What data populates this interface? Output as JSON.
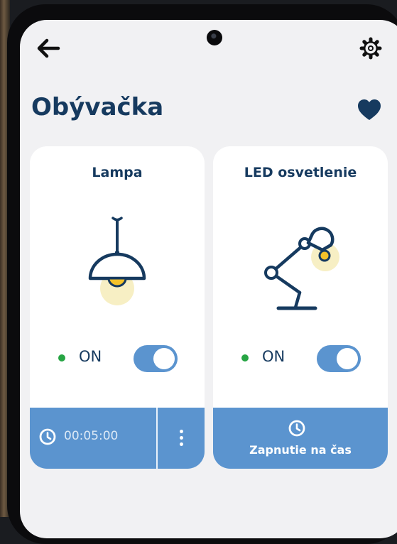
{
  "header": {
    "back_icon": "arrow-left-icon",
    "settings_icon": "gear-icon"
  },
  "room": {
    "title": "Obývačka",
    "favorite_icon": "heart-icon"
  },
  "devices": [
    {
      "name": "Lampa",
      "icon": "pendant-lamp-icon",
      "status": "ON",
      "switch_on": true,
      "timer": "00:05:00",
      "timer_icon": "clock-icon",
      "menu_icon": "more-vertical-icon"
    },
    {
      "name": "LED osvetlenie",
      "icon": "desk-lamp-icon",
      "status": "ON",
      "switch_on": true,
      "action_label": "Zapnutie na čas",
      "action_icon": "clock-icon"
    }
  ],
  "colors": {
    "accent": "#5b94cf",
    "title": "#163a5f",
    "status_on": "#27a544",
    "bulb_glow": "#f7efc4",
    "bulb": "#f4c22a"
  }
}
